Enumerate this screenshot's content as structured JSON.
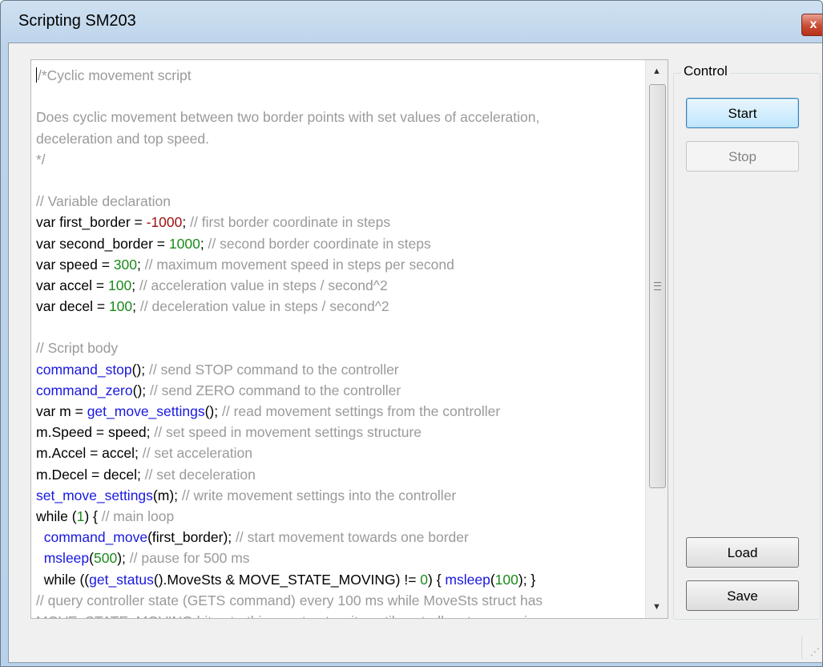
{
  "window": {
    "title": "Scripting SM203",
    "close_label": "x"
  },
  "editor": {
    "lines": [
      [
        {
          "t": "/*Cyclic movement script",
          "c": "comment"
        }
      ],
      [],
      [
        {
          "t": "Does cyclic movement between two border points with set values of acceleration,",
          "c": "comment"
        }
      ],
      [
        {
          "t": "deceleration and top speed.",
          "c": "comment"
        }
      ],
      [
        {
          "t": "*/",
          "c": "comment"
        }
      ],
      [],
      [
        {
          "t": "// Variable declaration",
          "c": "comment"
        }
      ],
      [
        {
          "t": "var first_border = "
        },
        {
          "t": "-1000",
          "c": "negnum"
        },
        {
          "t": "; "
        },
        {
          "t": "// first border coordinate in steps",
          "c": "comment"
        }
      ],
      [
        {
          "t": "var second_border = "
        },
        {
          "t": "1000",
          "c": "number"
        },
        {
          "t": "; "
        },
        {
          "t": "// second border coordinate in steps",
          "c": "comment"
        }
      ],
      [
        {
          "t": "var speed = "
        },
        {
          "t": "300",
          "c": "number"
        },
        {
          "t": "; "
        },
        {
          "t": "// maximum movement speed in steps per second",
          "c": "comment"
        }
      ],
      [
        {
          "t": "var accel = "
        },
        {
          "t": "100",
          "c": "number"
        },
        {
          "t": "; "
        },
        {
          "t": "// acceleration value in steps / second^2",
          "c": "comment"
        }
      ],
      [
        {
          "t": "var decel = "
        },
        {
          "t": "100",
          "c": "number"
        },
        {
          "t": "; "
        },
        {
          "t": "// deceleration value in steps / second^2",
          "c": "comment"
        }
      ],
      [],
      [
        {
          "t": "// Script body",
          "c": "comment"
        }
      ],
      [
        {
          "t": "command_stop",
          "c": "func"
        },
        {
          "t": "(); "
        },
        {
          "t": "// send STOP command to the controller",
          "c": "comment"
        }
      ],
      [
        {
          "t": "command_zero",
          "c": "func"
        },
        {
          "t": "(); "
        },
        {
          "t": "// send ZERO command to the controller",
          "c": "comment"
        }
      ],
      [
        {
          "t": "var m = "
        },
        {
          "t": "get_move_settings",
          "c": "func"
        },
        {
          "t": "(); "
        },
        {
          "t": "// read movement settings from the controller",
          "c": "comment"
        }
      ],
      [
        {
          "t": "m.Speed = speed; "
        },
        {
          "t": "// set speed in movement settings structure",
          "c": "comment"
        }
      ],
      [
        {
          "t": "m.Accel = accel; "
        },
        {
          "t": "// set acceleration",
          "c": "comment"
        }
      ],
      [
        {
          "t": "m.Decel = decel; "
        },
        {
          "t": "// set deceleration",
          "c": "comment"
        }
      ],
      [
        {
          "t": "set_move_settings",
          "c": "func"
        },
        {
          "t": "(m); "
        },
        {
          "t": "// write movement settings into the controller",
          "c": "comment"
        }
      ],
      [
        {
          "t": "while ("
        },
        {
          "t": "1",
          "c": "number"
        },
        {
          "t": ") { "
        },
        {
          "t": "// main loop",
          "c": "comment"
        }
      ],
      [
        {
          "t": "  "
        },
        {
          "t": "command_move",
          "c": "func"
        },
        {
          "t": "(first_border); "
        },
        {
          "t": "// start movement towards one border",
          "c": "comment"
        }
      ],
      [
        {
          "t": "  "
        },
        {
          "t": "msleep",
          "c": "func"
        },
        {
          "t": "("
        },
        {
          "t": "500",
          "c": "number"
        },
        {
          "t": "); "
        },
        {
          "t": "// pause for 500 ms",
          "c": "comment"
        }
      ],
      [
        {
          "t": "  while (("
        },
        {
          "t": "get_status",
          "c": "func"
        },
        {
          "t": "().MoveSts & MOVE_STATE_MOVING) != "
        },
        {
          "t": "0",
          "c": "number"
        },
        {
          "t": ") { "
        },
        {
          "t": "msleep",
          "c": "func"
        },
        {
          "t": "("
        },
        {
          "t": "100",
          "c": "number"
        },
        {
          "t": "); }"
        }
      ],
      [
        {
          "t": "// query controller state (GETS command) every 100 ms while MoveSts struct has",
          "c": "comment"
        }
      ],
      [
        {
          "t": "MOVE_STATE_MOVING bit set - this construct waits until controller stops moving",
          "c": "comment"
        }
      ]
    ],
    "scroll_position": 0.0
  },
  "control": {
    "group_label": "Control",
    "start_label": "Start",
    "stop_label": "Stop",
    "load_label": "Load",
    "save_label": "Save"
  },
  "icons": {
    "scroll_up": "triangle-up-icon",
    "scroll_down": "triangle-down-icon",
    "close": "close-icon",
    "resize": "resize-grip-icon"
  }
}
